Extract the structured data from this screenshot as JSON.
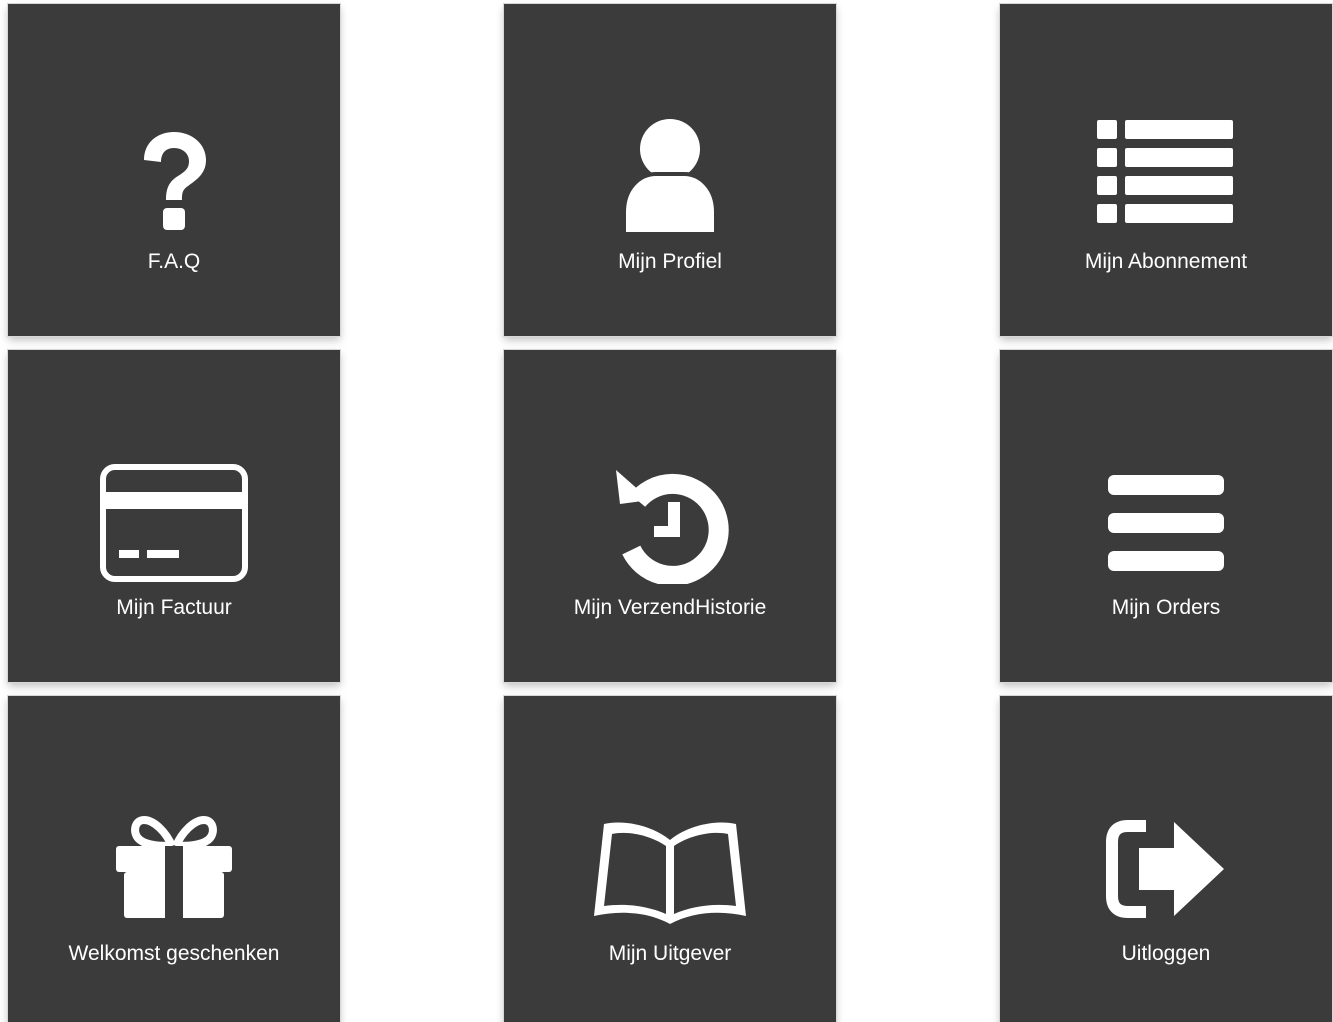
{
  "menu": {
    "tiles": [
      {
        "label": "F.A.Q",
        "icon": "question-icon"
      },
      {
        "label": "Mijn Profiel",
        "icon": "user-icon"
      },
      {
        "label": "Mijn Abonnement",
        "icon": "list-icon"
      },
      {
        "label": "Mijn Factuur",
        "icon": "credit-card-icon"
      },
      {
        "label": "Mijn VerzendHistorie",
        "icon": "history-icon"
      },
      {
        "label": "Mijn Orders",
        "icon": "bars-icon"
      },
      {
        "label": "Welkomst geschenken",
        "icon": "gift-icon"
      },
      {
        "label": "Mijn Uitgever",
        "icon": "open-book-icon"
      },
      {
        "label": "Uitloggen",
        "icon": "sign-out-icon"
      }
    ]
  },
  "colors": {
    "tile_background": "#3b3b3b",
    "icon_and_text": "#ffffff",
    "page_background": "#ffffff"
  }
}
